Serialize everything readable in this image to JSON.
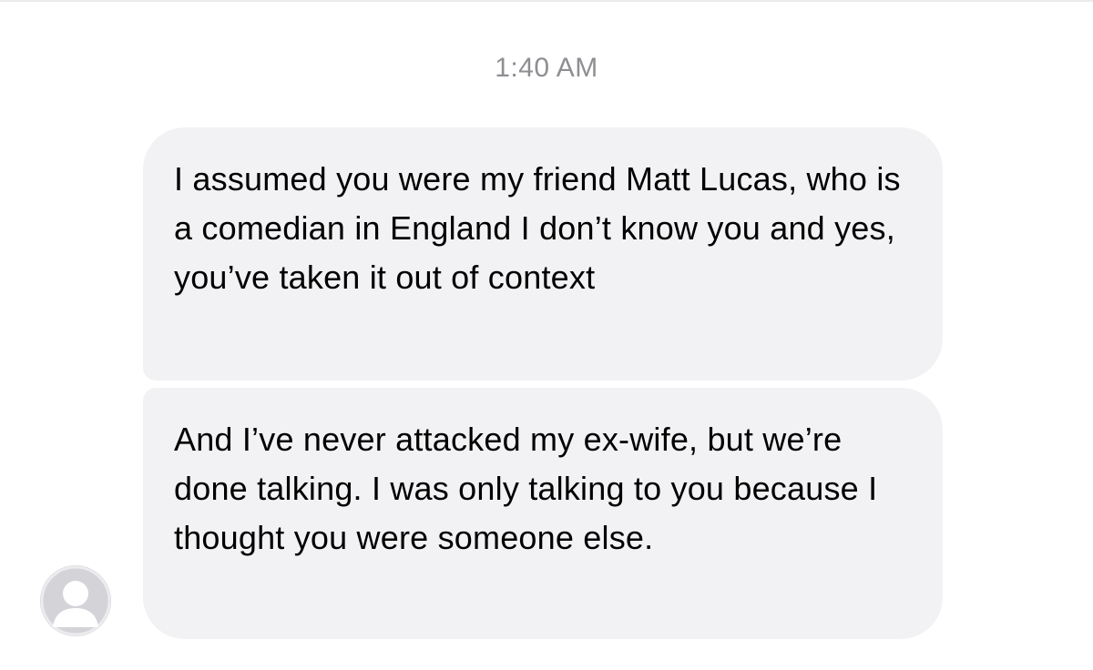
{
  "conversation": {
    "timestamp": "1:40 AM",
    "messages": [
      {
        "sender": "incoming",
        "text": "I assumed you were my friend Matt Lucas, who is a comedian in England I don’t know you and yes, you’ve taken it out of context"
      },
      {
        "sender": "incoming",
        "text": "And I’ve never attacked my ex-wife, but we’re done talking. I was only talking to you because I thought you were someone else."
      }
    ],
    "avatar_icon": "default-person-avatar-icon"
  },
  "colors": {
    "bubble_incoming": "#f2f2f4",
    "timestamp_text": "#8e8e93",
    "avatar_bg": "#d4d4d8"
  }
}
